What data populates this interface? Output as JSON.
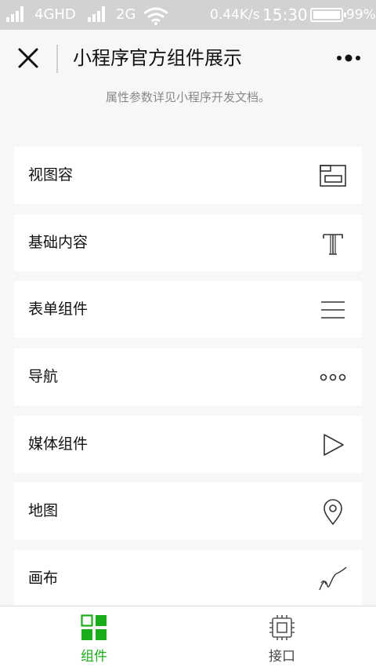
{
  "status_bar": {
    "network_1": "4GHD",
    "network_2": "2G",
    "speed": "0.44K/s",
    "time": "15:30",
    "battery": "99%"
  },
  "nav": {
    "title": "小程序官方组件展示",
    "close_icon": "close-icon",
    "more_icon": "more-icon"
  },
  "subtitle": "属性参数详见小程序开发文档。",
  "list": [
    {
      "label": "视图容",
      "icon": "view-container-icon"
    },
    {
      "label": "基础内容",
      "icon": "text-icon"
    },
    {
      "label": "表单组件",
      "icon": "form-lines-icon"
    },
    {
      "label": "导航",
      "icon": "dots-icon"
    },
    {
      "label": "媒体组件",
      "icon": "play-icon"
    },
    {
      "label": "地图",
      "icon": "location-pin-icon"
    },
    {
      "label": "画布",
      "icon": "canvas-curve-icon"
    }
  ],
  "tabs": [
    {
      "label": "组件",
      "icon": "components-grid-icon",
      "active": true
    },
    {
      "label": "接口",
      "icon": "chip-icon",
      "active": false
    }
  ],
  "colors": {
    "accent": "#1aad19",
    "tab_inactive": "#444444",
    "status_bar_bg": "#d2d2d2"
  }
}
